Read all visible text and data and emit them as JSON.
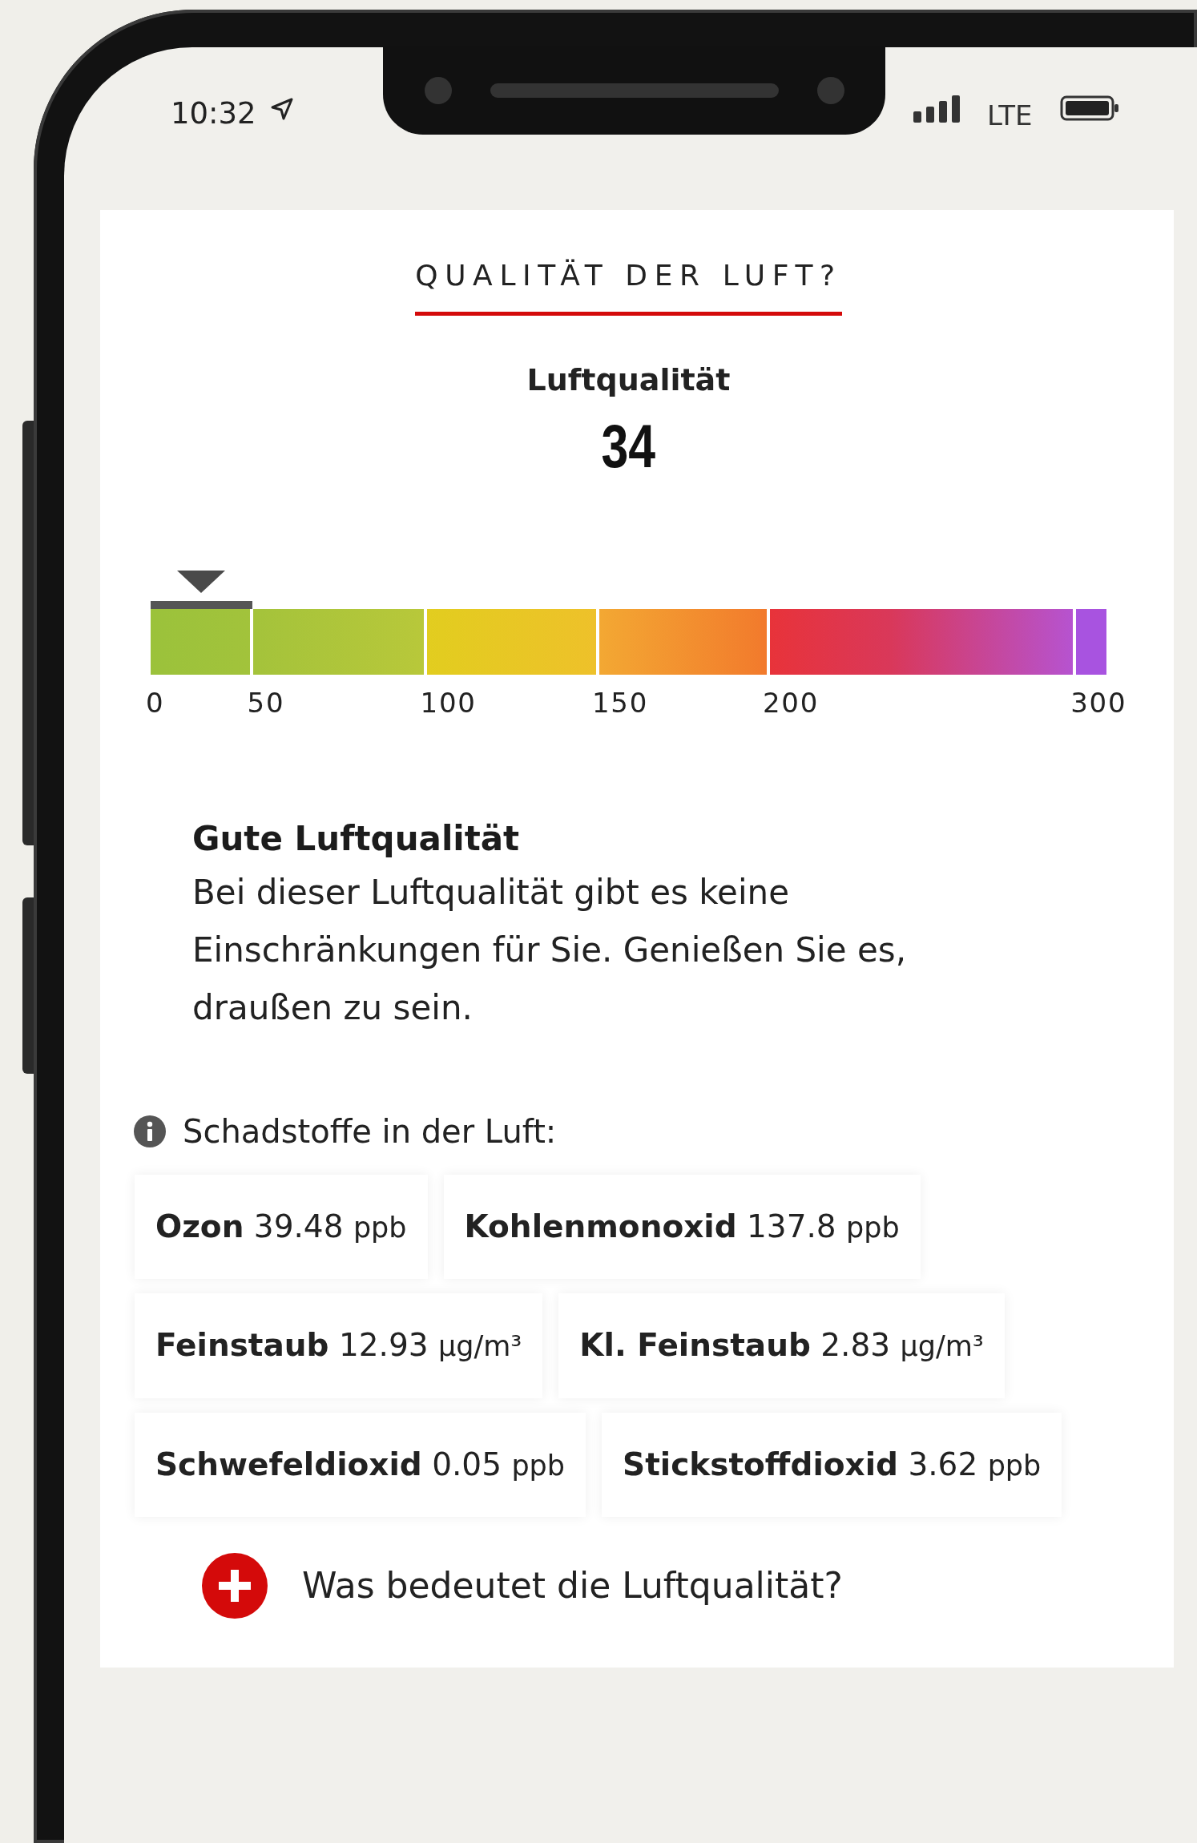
{
  "status_bar": {
    "time": "10:32",
    "network": "LTE"
  },
  "title": "QUALITÄT DER LUFT?",
  "aqi": {
    "label": "Luftqualität",
    "value": "34",
    "segments": [
      {
        "tick": "0",
        "selected": true
      },
      {
        "tick": "50",
        "selected": false
      },
      {
        "tick": "100",
        "selected": false
      },
      {
        "tick": "150",
        "selected": false
      },
      {
        "tick": "200",
        "selected": false
      },
      {
        "tick": "300",
        "selected": false
      }
    ]
  },
  "description": {
    "heading": "Gute Luftqualität",
    "text": "Bei dieser Luftqualität gibt es keine Einschränkungen für Sie. Genießen Sie es, draußen zu sein."
  },
  "pollutants_heading": "Schadstoffe in der Luft:",
  "pollutants": [
    {
      "name": "Ozon",
      "value": "39.48",
      "unit": "ppb"
    },
    {
      "name": "Kohlenmonoxid",
      "value": "137.8",
      "unit": "ppb"
    },
    {
      "name": "Feinstaub",
      "value": "12.93",
      "unit": "µg/m³"
    },
    {
      "name": "Kl. Feinstaub",
      "value": "2.83",
      "unit": "µg/m³"
    },
    {
      "name": "Schwefeldioxid",
      "value": "0.05",
      "unit": "ppb"
    },
    {
      "name": "Stickstoffdioxid",
      "value": "3.62",
      "unit": "ppb"
    }
  ],
  "more_link": "Was bedeutet die Luftqualität?"
}
